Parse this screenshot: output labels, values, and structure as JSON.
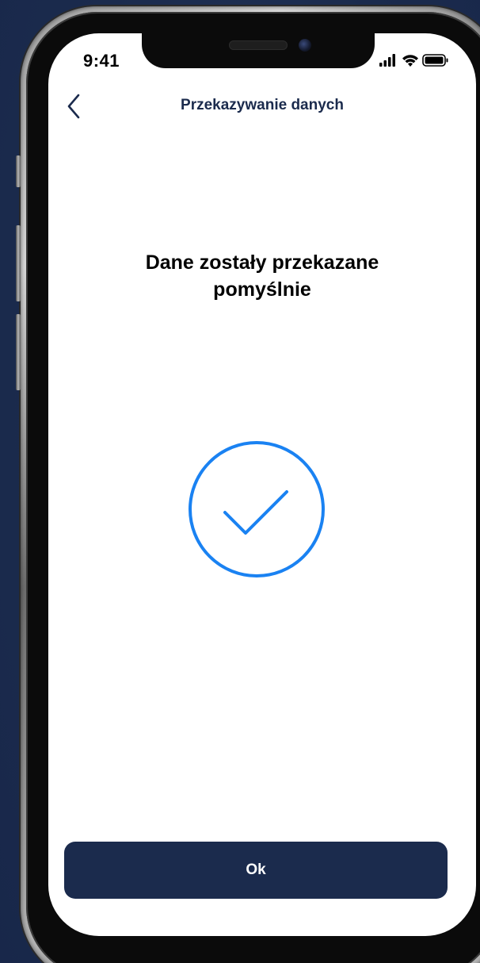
{
  "status_bar": {
    "time": "9:41",
    "icons": [
      "signal-icon",
      "wifi-icon",
      "battery-icon"
    ]
  },
  "nav": {
    "back_icon": "chevron-left-icon",
    "title": "Przekazywanie danych"
  },
  "main": {
    "message": "Dane zostały przekazane\npomyślnie",
    "status_icon": "check-circle-icon",
    "accent_color": "#1a82f2"
  },
  "actions": {
    "ok_label": "Ok",
    "button_color": "#1b2b4d"
  }
}
